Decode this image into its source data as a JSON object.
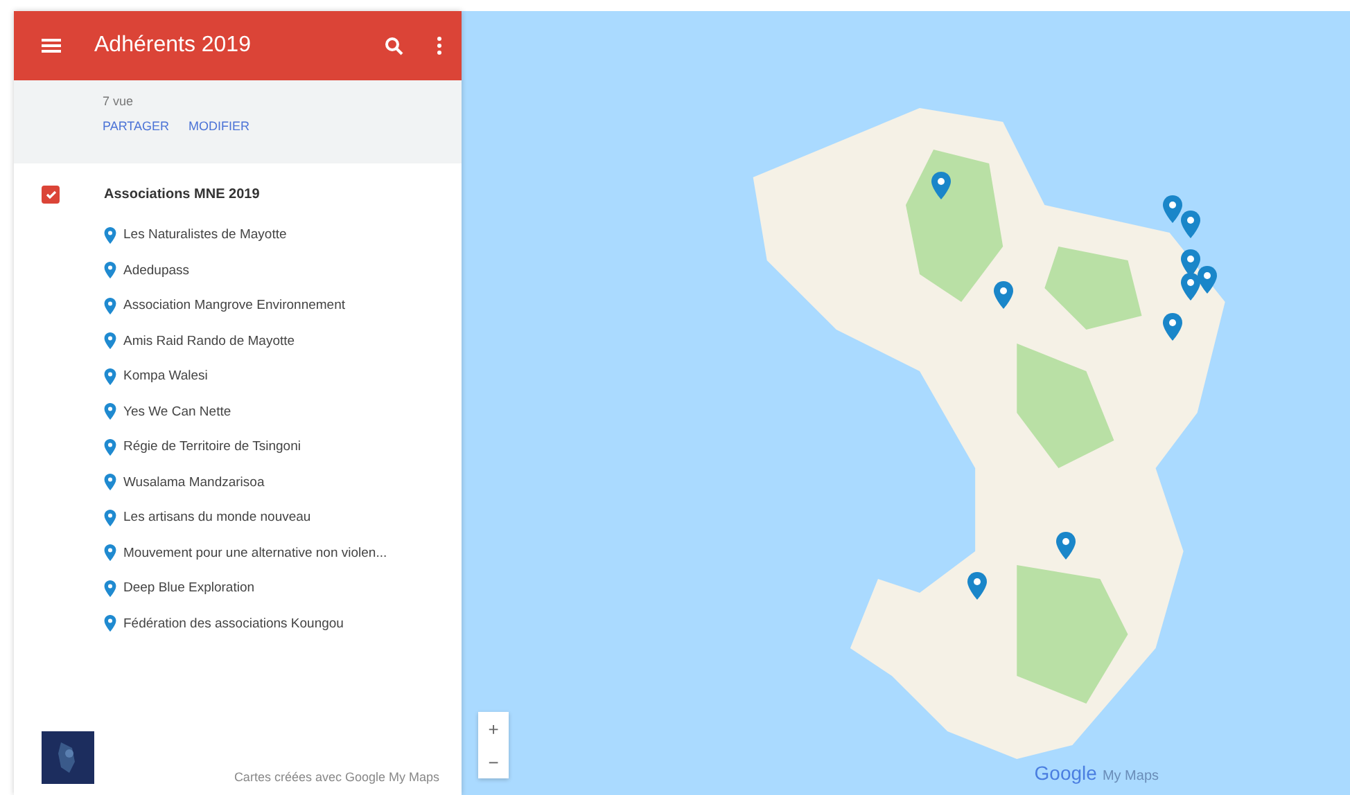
{
  "header": {
    "title": "Adhérents 2019"
  },
  "info": {
    "views": "7 vue",
    "actions": [
      "PARTAGER",
      "MODIFIER"
    ]
  },
  "layer": {
    "title": "Associations MNE 2019",
    "checked": true,
    "items": [
      "Les Naturalistes de Mayotte",
      "Adedupass",
      "Association Mangrove Environnement",
      "Amis Raid Rando de Mayotte",
      "Kompa Walesi",
      "Yes We Can Nette",
      "Régie de Territoire de Tsingoni",
      "Wusalama Mandzarisoa",
      "Les artisans du monde nouveau",
      "Mouvement pour une alternative non violen...",
      "Deep Blue Exploration",
      "Fédération des associations Koungou"
    ]
  },
  "footer": {
    "credit": "Cartes créées avec Google My Maps"
  },
  "map": {
    "zoom": [
      "+",
      "−"
    ],
    "logo": {
      "brand": "Google",
      "product": "My Maps"
    }
  }
}
